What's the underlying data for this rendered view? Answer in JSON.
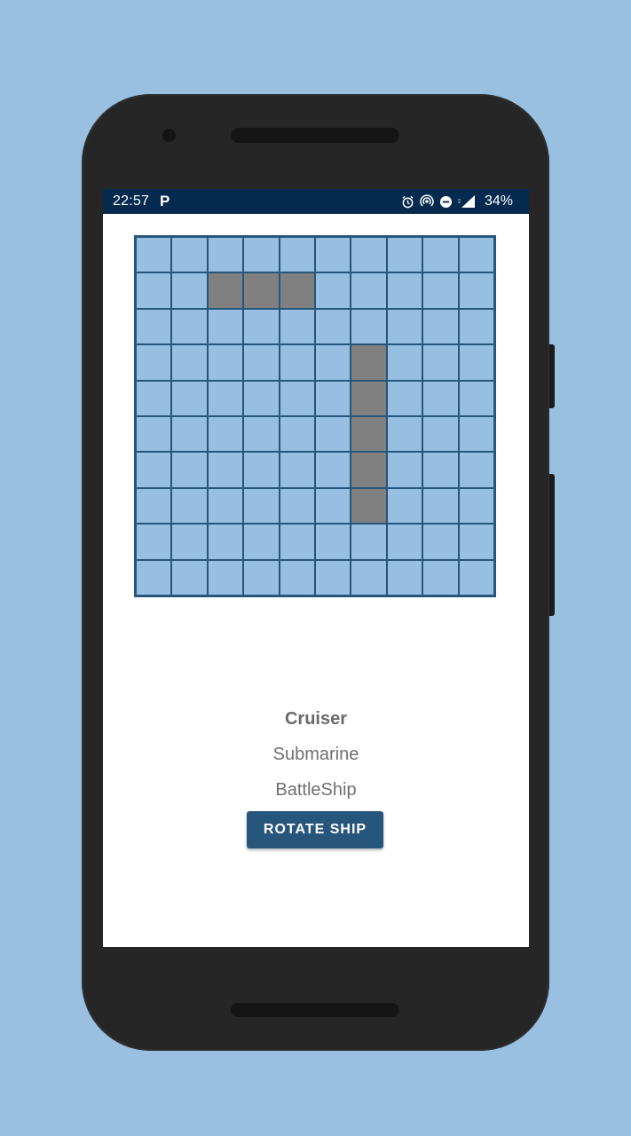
{
  "status_bar": {
    "time": "22:57",
    "parking_icon": "P",
    "battery": "34%",
    "icons": [
      "alarm-icon",
      "hotspot-icon",
      "do-not-disturb-icon",
      "signal-icon"
    ]
  },
  "board": {
    "rows": 10,
    "cols": 10,
    "ship_cells": [
      [
        1,
        2
      ],
      [
        1,
        3
      ],
      [
        1,
        4
      ],
      [
        3,
        6
      ],
      [
        4,
        6
      ],
      [
        5,
        6
      ],
      [
        6,
        6
      ],
      [
        7,
        6
      ]
    ],
    "water_color": "#97bfe1",
    "ship_color": "#808080",
    "grid_color": "#27567d"
  },
  "ships": [
    {
      "label": "Cruiser",
      "selected": true
    },
    {
      "label": "Submarine",
      "selected": false
    },
    {
      "label": "BattleShip",
      "selected": false
    }
  ],
  "rotate_button": {
    "label": "ROTATE SHIP"
  },
  "colors": {
    "background": "#99bfe1",
    "status_bar": "#052a4f",
    "accent": "#27567d"
  }
}
